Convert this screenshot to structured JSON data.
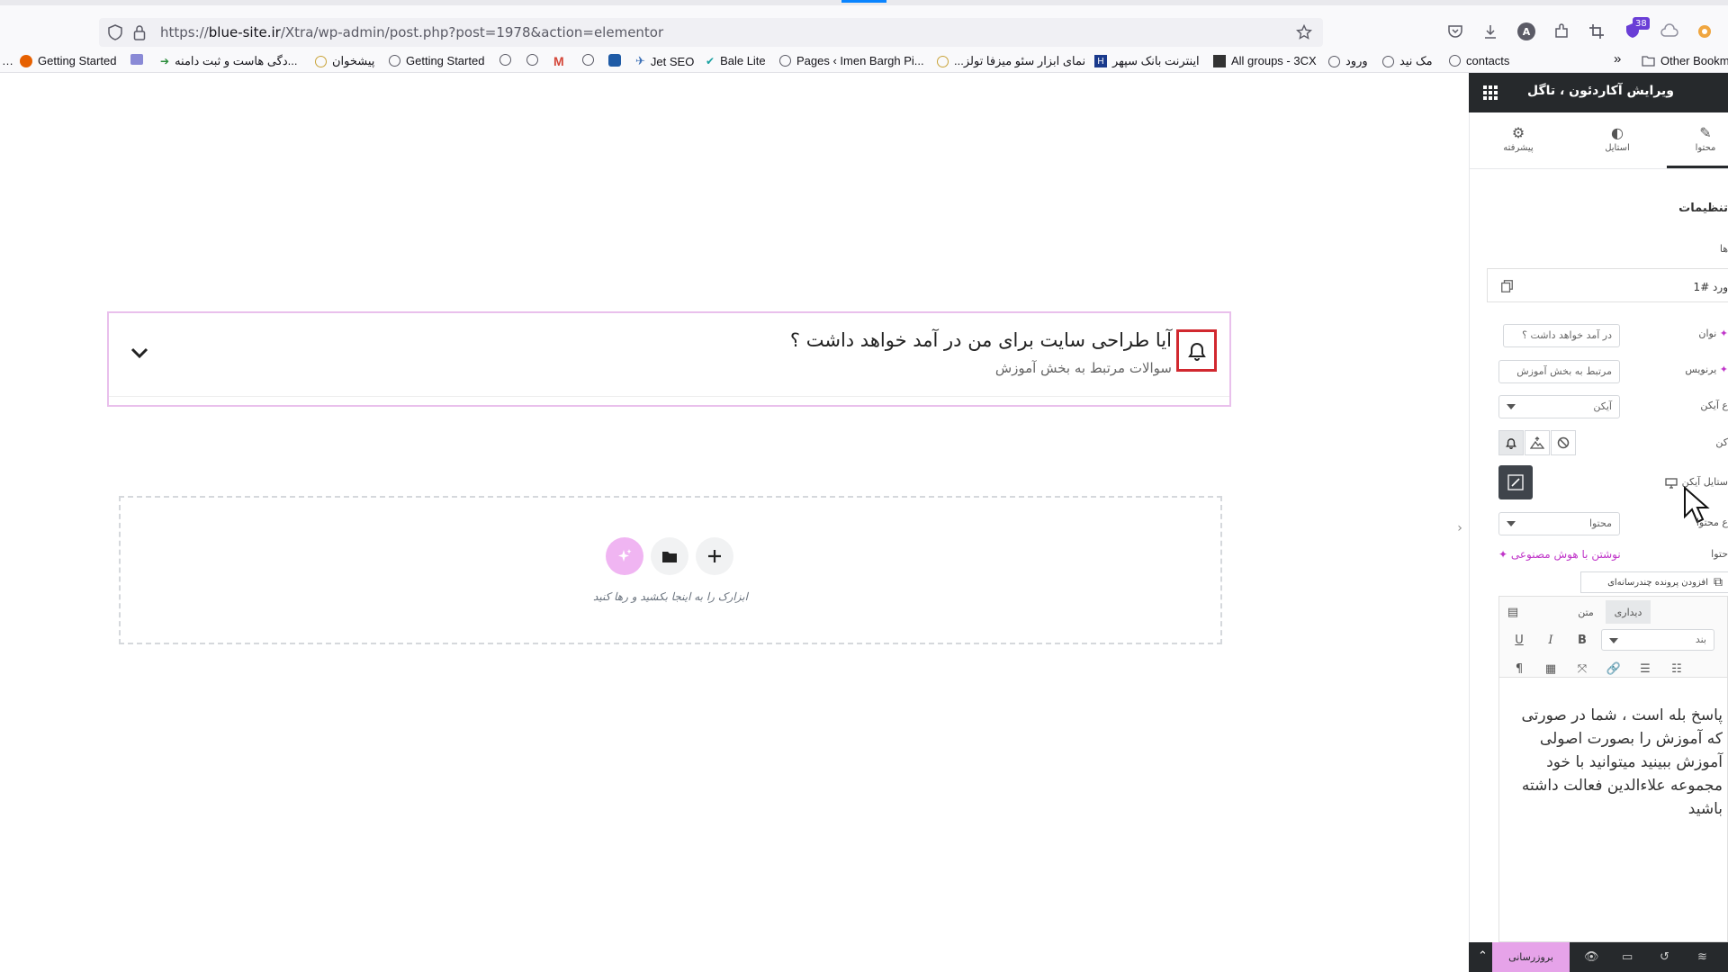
{
  "browser": {
    "url_prefix": "https://",
    "url_domain": "blue-site.ir",
    "url_path": "/Xtra/wp-admin/post.php?post=1978&action=elementor",
    "badge_count": "38",
    "bookmarks": [
      {
        "label": "Getting Started"
      },
      {
        "label": "دگی هاست و ثبت دامنه..."
      },
      {
        "label": "پیشخوان"
      },
      {
        "label": "Getting Started"
      },
      {
        "label": "Jet SEO"
      },
      {
        "label": "Bale Lite"
      },
      {
        "label": "Pages ‹ Imen Bargh Pi..."
      },
      {
        "label": "...نمای ابزار سئو میزفا تولز"
      },
      {
        "label": "اینترنت بانک سپهر"
      },
      {
        "label": "All groups - 3CX"
      },
      {
        "label": "ورود"
      },
      {
        "label": "مک نید"
      },
      {
        "label": "contacts"
      },
      {
        "label": "Other Bookm"
      }
    ]
  },
  "canvas": {
    "accordion": {
      "title": "آیا طراحی سایت برای من در آمد خواهد داشت ؟",
      "subtitle": "سوالات مرتبط به بخش آموزش"
    },
    "dropzone": {
      "text": "ابزارک را به اینجا بکشید و رها کنید"
    }
  },
  "panel": {
    "title": "ویرایش آکاردئون ، تاگل",
    "tabs": [
      {
        "label": "محتوا"
      },
      {
        "label": "استایل"
      },
      {
        "label": "پیشرفته"
      }
    ],
    "section_title": "تنظیمات",
    "items_label": "ها",
    "item_name": "ورد #1",
    "fields": {
      "title_label": "نوان",
      "title_value": "در آمد خواهد داشت ؟",
      "subtitle_label": "یرنویس",
      "subtitle_value": "مرتبط به بخش آموزش",
      "icon_type_label": "ع آیکن",
      "icon_type_value": "آیکن",
      "icon_label": "کن",
      "icon_style_label": "ستایل آیکن",
      "content_type_label": "ع محتوا",
      "content_type_value": "محتوا",
      "content_label": "حتوا",
      "ai_link": "نوشتن با هوش مصنوعی",
      "add_media": "افزودن پرونده چندرسانه‌ای"
    },
    "editor": {
      "tab_visual": "دیداری",
      "tab_text": "متن",
      "format_value": "بند",
      "body": "پاسخ بله است ، شما در صورتی که آموزش را بصورت اصولی آموزش ببینید میتوانید با خود مجموعه علاءالدین فعالت داشته باشید"
    },
    "footer": {
      "publish": "بروزرسانی"
    }
  },
  "colors": {
    "panel_dark": "#26292c",
    "accent_pink": "#e6a3e9",
    "ai_purple": "#c036c9",
    "icon_highlight": "#d1282f"
  }
}
